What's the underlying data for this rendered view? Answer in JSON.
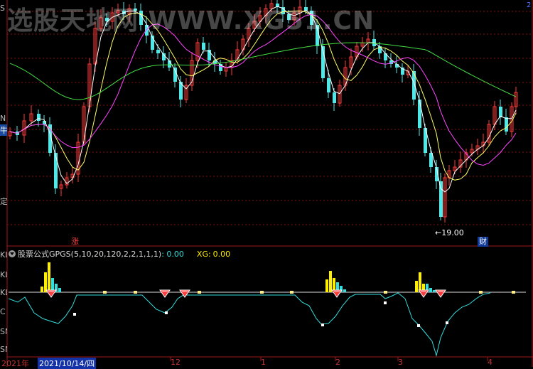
{
  "watermark": "选股天地网 WWW.XG51.CN",
  "price_low_label": "←19.00",
  "rise_badge": "涨",
  "finance_badge": "财",
  "indicator": {
    "name": "股票公式GPGS(5,10,20,120,2,2,1,1,1)",
    "value": ": 0.00",
    "xg_label": "XG:",
    "xg_value": "0.00"
  },
  "x_axis": {
    "start_year": "2021年",
    "cursor_date": "2021/10/14/四",
    "ticks": [
      "12",
      "1",
      "2",
      "3",
      "4"
    ]
  },
  "top_right_tag": "2",
  "left_edge_labels": [
    "S",
    "N",
    "牛",
    "定",
    "KL",
    "KL",
    "KL",
    "C",
    "SN",
    "SN"
  ],
  "colors": {
    "up": "#ff3b3b",
    "down": "#4ee8e8",
    "ma5": "#ffffff",
    "ma10": "#ffff66",
    "ma20": "#ff44ff",
    "ma120": "#44dd44",
    "grid": "#8a1010",
    "signal_yellow": "#ffee00",
    "signal_cyan": "#33dddd"
  }
}
